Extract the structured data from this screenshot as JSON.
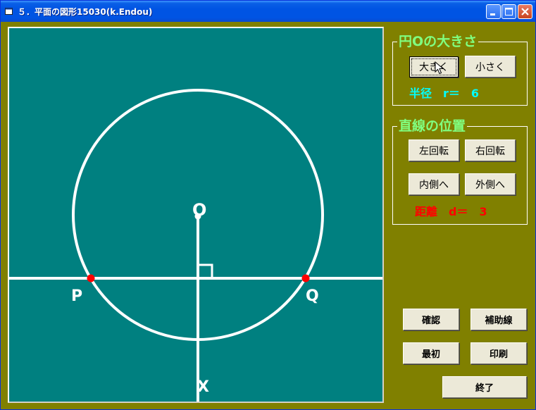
{
  "window": {
    "title": "５．平面の図形15030(k.Endou)"
  },
  "figure": {
    "center_label": "O",
    "left_point_label": "P",
    "right_point_label": "Q",
    "foot_label": "X"
  },
  "size_group": {
    "legend": "円Oの大きさ",
    "bigger_label": "大きく",
    "smaller_label": "小さく",
    "radius_text": "半径　r＝　6"
  },
  "line_group": {
    "legend": "直線の位置",
    "rotate_left_label": "左回転",
    "rotate_right_label": "右回転",
    "inward_label": "内側へ",
    "outward_label": "外側へ",
    "distance_text": "距離　d＝　3"
  },
  "actions": {
    "confirm_label": "確認",
    "aux_line_label": "補助線",
    "reset_label": "最初",
    "print_label": "印刷",
    "exit_label": "終了"
  },
  "values": {
    "radius": 6,
    "distance": 3
  },
  "colors": {
    "window_bg": "#808000",
    "canvas_bg": "#008080",
    "legend_text": "#80ff80",
    "radius_text": "#00ffff",
    "distance_text": "#ff0000",
    "intersection_point": "#ff0000"
  }
}
